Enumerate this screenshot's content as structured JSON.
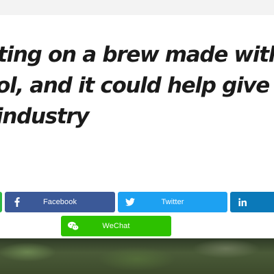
{
  "article": {
    "headline_lines": [
      "ting on a brew made with ma",
      "ol, and it could help give a bo",
      "industry"
    ]
  },
  "share": {
    "facebook": {
      "label": "Facebook",
      "icon": "facebook-icon",
      "color": "#3b5998"
    },
    "twitter": {
      "label": "Twitter",
      "icon": "twitter-icon",
      "color": "#1da1f2"
    },
    "linkedin": {
      "label": "",
      "icon": "linkedin-icon",
      "color": "#0b79b9"
    },
    "wechat": {
      "label": "WeChat",
      "icon": "wechat-icon",
      "color": "#2dc100"
    },
    "partial_left": {
      "color": "#2fb844"
    }
  }
}
